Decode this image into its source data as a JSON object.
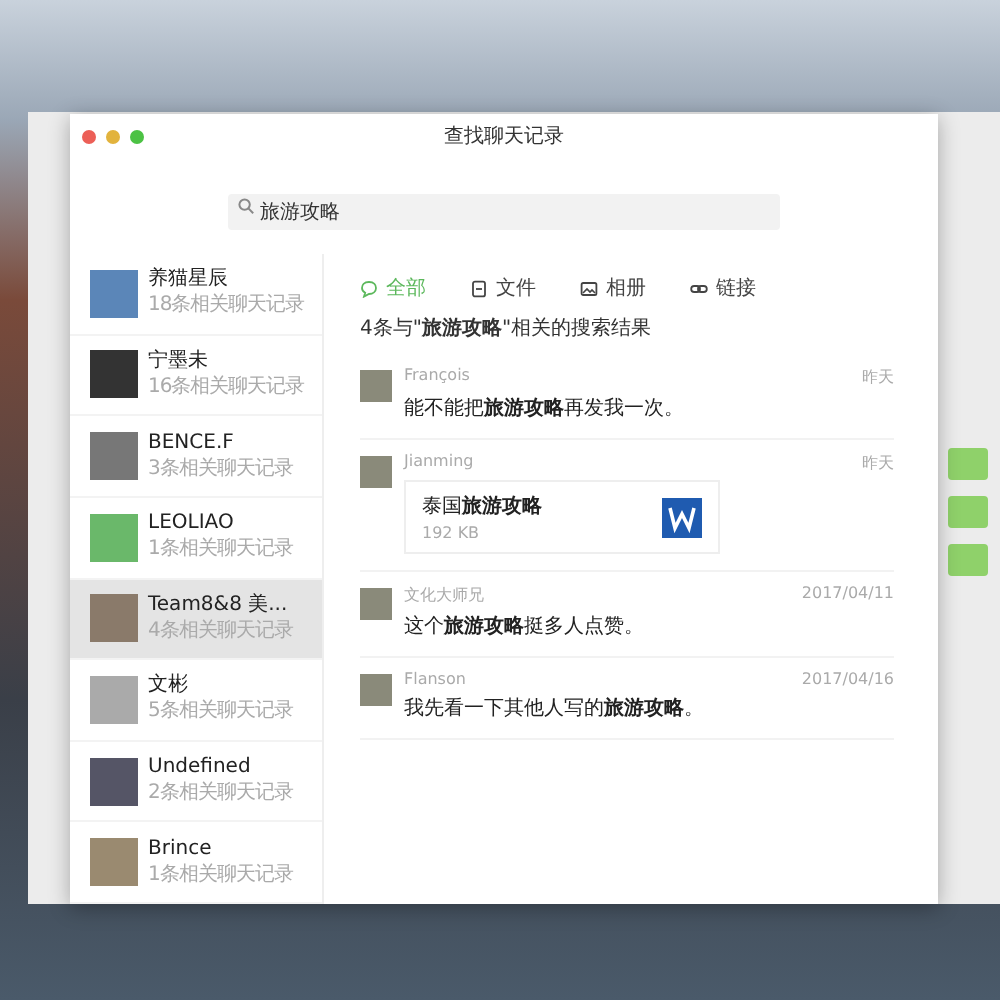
{
  "window": {
    "title": "查找聊天记录"
  },
  "search": {
    "value": "旅游攻略"
  },
  "contacts": [
    {
      "name": "养猫星辰",
      "count": "18条相关聊天记录",
      "selected": false
    },
    {
      "name": "宁墨未",
      "count": "16条相关聊天记录",
      "selected": false
    },
    {
      "name": "BENCE.F",
      "count": "3条相关聊天记录",
      "selected": false
    },
    {
      "name": "LEOLIAO",
      "count": "1条相关聊天记录",
      "selected": false
    },
    {
      "name": "Team8&8 美...",
      "count": "4条相关聊天记录",
      "selected": true
    },
    {
      "name": "文彬",
      "count": "5条相关聊天记录",
      "selected": false
    },
    {
      "name": "Undefined",
      "count": "2条相关聊天记录",
      "selected": false
    },
    {
      "name": "Brince",
      "count": "1条相关聊天记录",
      "selected": false
    }
  ],
  "tabs": [
    {
      "label": "全部",
      "kind": "chat",
      "selected": true
    },
    {
      "label": "文件",
      "kind": "file",
      "selected": false
    },
    {
      "label": "相册",
      "kind": "image",
      "selected": false
    },
    {
      "label": "链接",
      "kind": "link",
      "selected": false
    }
  ],
  "summary": "4条与\"**旅游攻略**\"相关的搜索结果",
  "results": [
    {
      "kind": "text",
      "sender": "François",
      "time": "昨天",
      "text": "能不能把**旅游攻略**再发我一次。"
    },
    {
      "kind": "file",
      "sender": "Jianming",
      "time": "昨天",
      "file_name": "泰国**旅游攻略**",
      "file_size": "192 KB"
    },
    {
      "kind": "text",
      "sender": "文化大师兄",
      "time": "2017/04/11",
      "text": "这个**旅游攻略**挺多人点赞。"
    },
    {
      "kind": "text",
      "sender": "Flanson",
      "time": "2017/04/16",
      "text": "我先看一下其他人写的**旅游攻略**。"
    }
  ]
}
